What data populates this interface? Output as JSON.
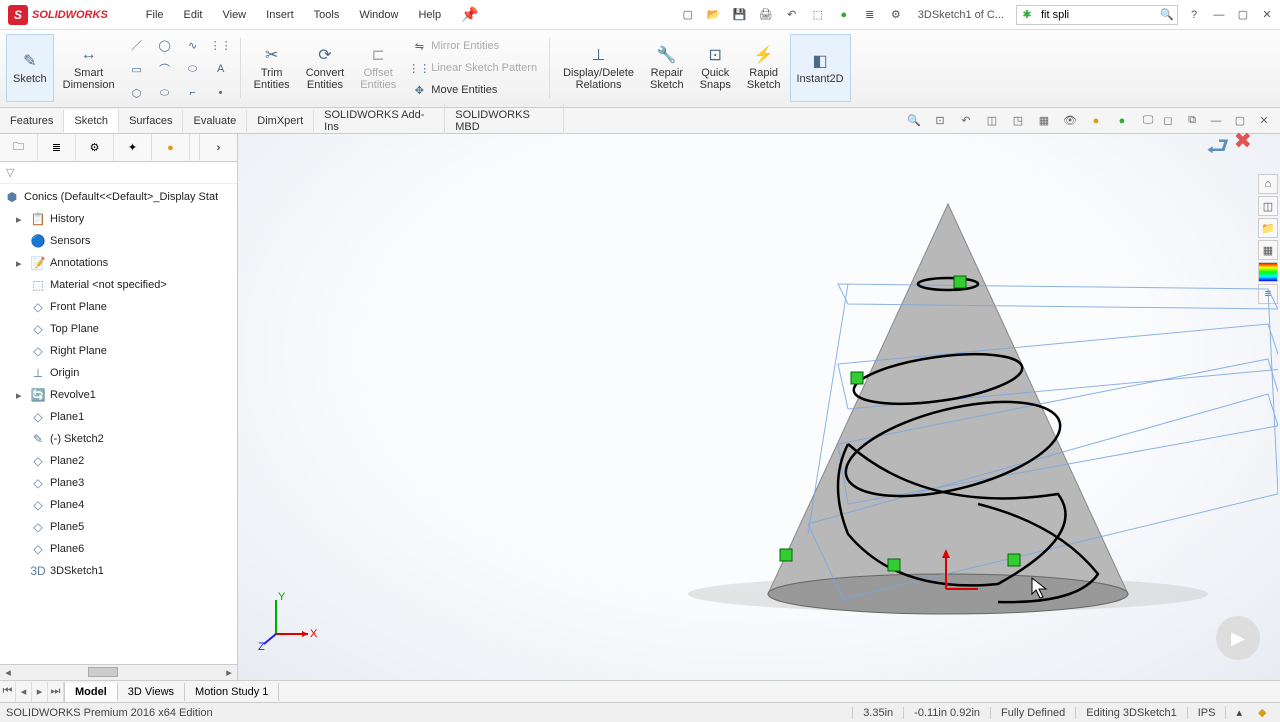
{
  "app": {
    "name": "SOLIDWORKS"
  },
  "menu": [
    "File",
    "Edit",
    "View",
    "Insert",
    "Tools",
    "Window",
    "Help"
  ],
  "title_doc": "3DSketch1 of C...",
  "search_value": "fit spli",
  "quick_icons": [
    "□",
    "▾",
    "💾",
    "🖨",
    "↶",
    "▸",
    "⚙",
    "≣",
    "⚙"
  ],
  "ribbon": {
    "sketch": "Sketch",
    "smart_dim": "Smart\nDimension",
    "trim": "Trim\nEntities",
    "convert": "Convert\nEntities",
    "offset": "Offset\nEntities",
    "mirror": "Mirror Entities",
    "pattern": "Linear Sketch Pattern",
    "move": "Move Entities",
    "display": "Display/Delete\nRelations",
    "repair": "Repair\nSketch",
    "quick_snaps": "Quick\nSnaps",
    "rapid": "Rapid\nSketch",
    "instant": "Instant2D"
  },
  "tabs": [
    "Features",
    "Sketch",
    "Surfaces",
    "Evaluate",
    "DimXpert",
    "SOLIDWORKS Add-Ins",
    "SOLIDWORKS MBD"
  ],
  "active_tab": "Sketch",
  "tree": {
    "root": "Conics  (Default<<Default>_Display Stat",
    "items": [
      {
        "icon": "📋",
        "label": "History",
        "exp": "▸"
      },
      {
        "icon": "🔵",
        "label": "Sensors"
      },
      {
        "icon": "📝",
        "label": "Annotations",
        "exp": "▸"
      },
      {
        "icon": "⬚",
        "label": "Material <not specified>"
      },
      {
        "icon": "◇",
        "label": "Front Plane"
      },
      {
        "icon": "◇",
        "label": "Top Plane"
      },
      {
        "icon": "◇",
        "label": "Right Plane"
      },
      {
        "icon": "⊥",
        "label": "Origin"
      },
      {
        "icon": "🔄",
        "label": "Revolve1",
        "exp": "▸"
      },
      {
        "icon": "◇",
        "label": "Plane1"
      },
      {
        "icon": "✎",
        "label": "(-) Sketch2"
      },
      {
        "icon": "◇",
        "label": "Plane2"
      },
      {
        "icon": "◇",
        "label": "Plane3"
      },
      {
        "icon": "◇",
        "label": "Plane4"
      },
      {
        "icon": "◇",
        "label": "Plane5"
      },
      {
        "icon": "◇",
        "label": "Plane6"
      },
      {
        "icon": "3D",
        "label": "3DSketch1"
      }
    ]
  },
  "bottom_tabs": [
    "Model",
    "3D Views",
    "Motion Study 1"
  ],
  "active_bottom_tab": "Model",
  "status": {
    "edition": "SOLIDWORKS Premium 2016 x64 Edition",
    "coord1": "3.35in",
    "coord2": "-0.11in  0.92in",
    "defined": "Fully Defined",
    "editing": "Editing 3DSketch1",
    "units": "IPS"
  },
  "triad": {
    "x": "X",
    "y": "Y",
    "z": "Z"
  }
}
